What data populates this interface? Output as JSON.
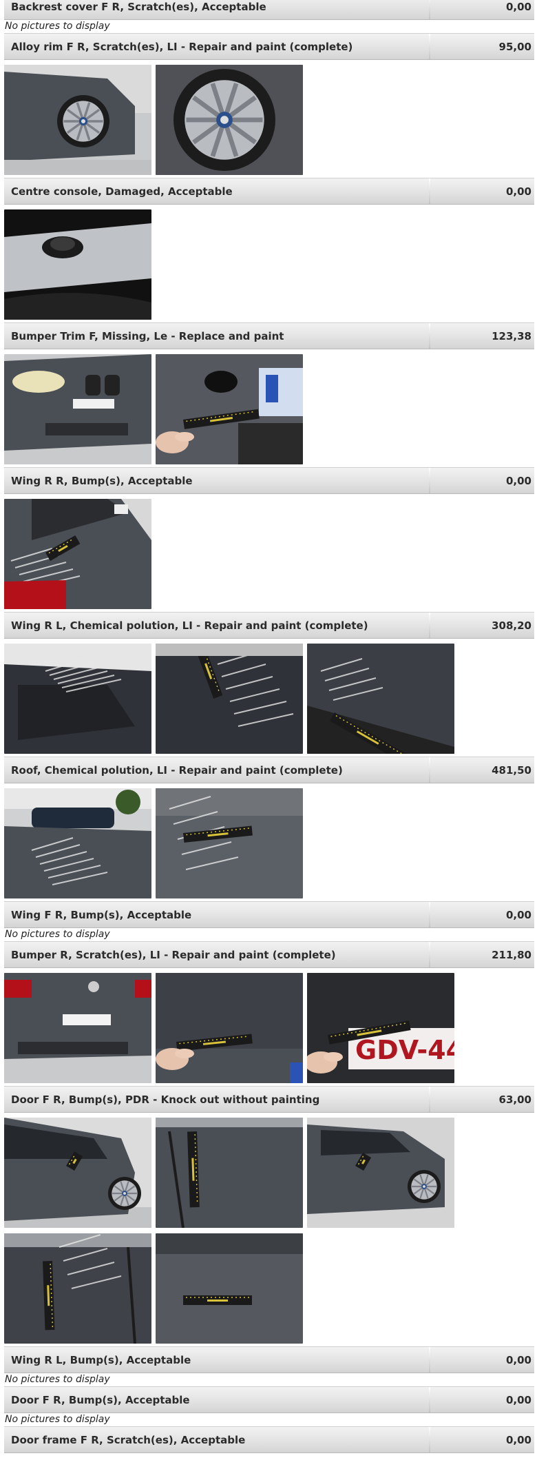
{
  "entries": [
    {
      "description": "Backrest cover F R, Scratch(es), Acceptable",
      "amount": "0,00",
      "no_pictures": "No pictures to display"
    },
    {
      "description": "Alloy rim F R, Scratch(es), LI - Repair and paint (complete)",
      "amount": "95,00",
      "photos": [
        "rim-car-side",
        "rim-closeup"
      ]
    },
    {
      "description": "Centre console, Damaged, Acceptable",
      "amount": "0,00",
      "photos": [
        "centre-console"
      ]
    },
    {
      "description": "Bumper Trim F, Missing, Le - Replace and paint",
      "amount": "123,38",
      "photos": [
        "front-bumper",
        "bumper-trim-gauge"
      ]
    },
    {
      "description": "Wing R R, Bump(s), Acceptable",
      "amount": "0,00",
      "photos": [
        "rear-wing-taillight"
      ]
    },
    {
      "description": "Wing R L, Chemical polution, LI - Repair and paint (complete)",
      "amount": "308,20",
      "photos": [
        "rear-window-roof",
        "paint-ruler",
        "paint-ruler-close"
      ]
    },
    {
      "description": "Roof, Chemical polution, LI - Repair and paint (complete)",
      "amount": "481,50",
      "photos": [
        "roof-showroom",
        "roof-ruler"
      ]
    },
    {
      "description": "Wing F R, Bump(s), Acceptable",
      "amount": "0,00",
      "no_pictures": "No pictures to display"
    },
    {
      "description": "Bumper R, Scratch(es), LI - Repair and paint (complete)",
      "amount": "211,80",
      "photos": [
        "rear-bumper",
        "rear-bumper-gauge",
        "plate-gauge"
      ]
    },
    {
      "description": "Door F R, Bump(s), PDR - Knock out without painting",
      "amount": "63,00",
      "photos": [
        "door-side",
        "door-gauge",
        "door-side-2",
        "door-gauge-2",
        "door-closeup"
      ]
    },
    {
      "description": "Wing R L, Bump(s), Acceptable",
      "amount": "0,00",
      "no_pictures": "No pictures to display"
    },
    {
      "description": "Door F R, Bump(s), Acceptable",
      "amount": "0,00",
      "no_pictures": "No pictures to display"
    },
    {
      "description": "Door frame F R, Scratch(es), Acceptable",
      "amount": "0,00"
    }
  ],
  "colors": {
    "car_grey": "#4a4e55",
    "floor": "#c9cacb",
    "gauge": "#d8c23a",
    "tail_red": "#b3101a"
  }
}
